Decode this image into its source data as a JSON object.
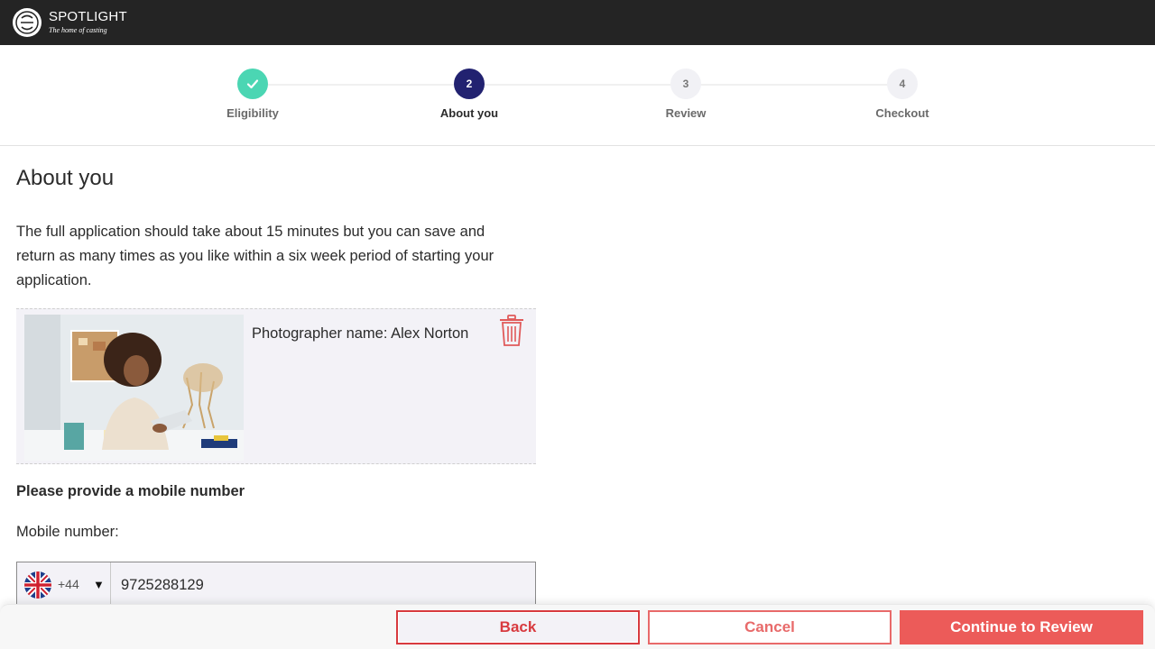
{
  "header": {
    "brand": "SPOTLIGHT",
    "tagline": "The home of casting"
  },
  "stepper": {
    "steps": [
      {
        "number": "1",
        "label": "Eligibility",
        "state": "done"
      },
      {
        "number": "2",
        "label": "About you",
        "state": "active"
      },
      {
        "number": "3",
        "label": "Review",
        "state": "todo"
      },
      {
        "number": "4",
        "label": "Checkout",
        "state": "todo"
      }
    ]
  },
  "main": {
    "title": "About you",
    "intro": "The full application should take about 15 minutes but you can save and return as many times as you like within a six week period of starting your application.",
    "photo": {
      "photographer": "Photographer name: Alex Norton",
      "delete_icon": "trash-icon"
    },
    "mobile": {
      "heading": "Please provide a mobile number",
      "label": "Mobile number:",
      "country_flag": "uk-flag-icon",
      "dial_code": "+44",
      "value": "9725288129"
    }
  },
  "footer": {
    "back_label": "Back",
    "cancel_label": "Cancel",
    "continue_label": "Continue to Review"
  },
  "colors": {
    "header_bg": "#242424",
    "step_done": "#4bd6b3",
    "step_active": "#222270",
    "accent": "#ec5b59"
  }
}
